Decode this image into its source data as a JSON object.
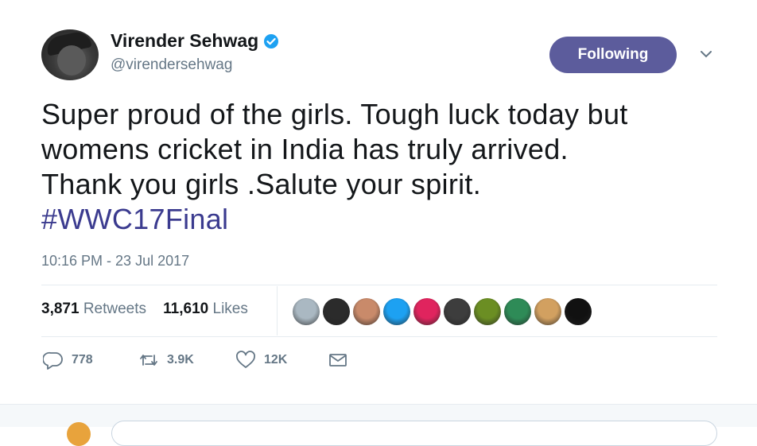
{
  "user": {
    "name": "Virender Sehwag",
    "handle": "@virendersehwag",
    "verified_icon": "verified-badge-icon"
  },
  "follow_button": {
    "label": "Following",
    "color": "#5c5c9c"
  },
  "tweet": {
    "lines": [
      "Super proud of the girls. Tough luck today but",
      "womens cricket in India has truly arrived.",
      "Thank you girls .Salute your spirit."
    ],
    "hashtag": "#WWC17Final",
    "timestamp": "10:16 PM - 23 Jul 2017"
  },
  "stats": {
    "retweets_count": "3,871",
    "retweets_label": "Retweets",
    "likes_count": "11,610",
    "likes_label": "Likes"
  },
  "likers": [
    {
      "icon": "default-avatar",
      "color": "#aab8c2"
    },
    {
      "icon": "avatar",
      "color": "#2b2b2b"
    },
    {
      "icon": "avatar",
      "color": "#c98a6a"
    },
    {
      "icon": "twitter-bird-avatar",
      "color": "#1da1f2"
    },
    {
      "icon": "avatar",
      "color": "#e0245e"
    },
    {
      "icon": "avatar",
      "color": "#3d3d3d"
    },
    {
      "icon": "avatar",
      "color": "#6b8e23"
    },
    {
      "icon": "avatar",
      "color": "#2e8b57"
    },
    {
      "icon": "avatar",
      "color": "#d2a060"
    },
    {
      "icon": "avatar",
      "color": "#111111"
    }
  ],
  "actions": {
    "replies": "778",
    "retweets": "3.9K",
    "likes": "12K"
  },
  "colors": {
    "hashtag": "#3b3b8f",
    "secondary_text": "#657786"
  }
}
